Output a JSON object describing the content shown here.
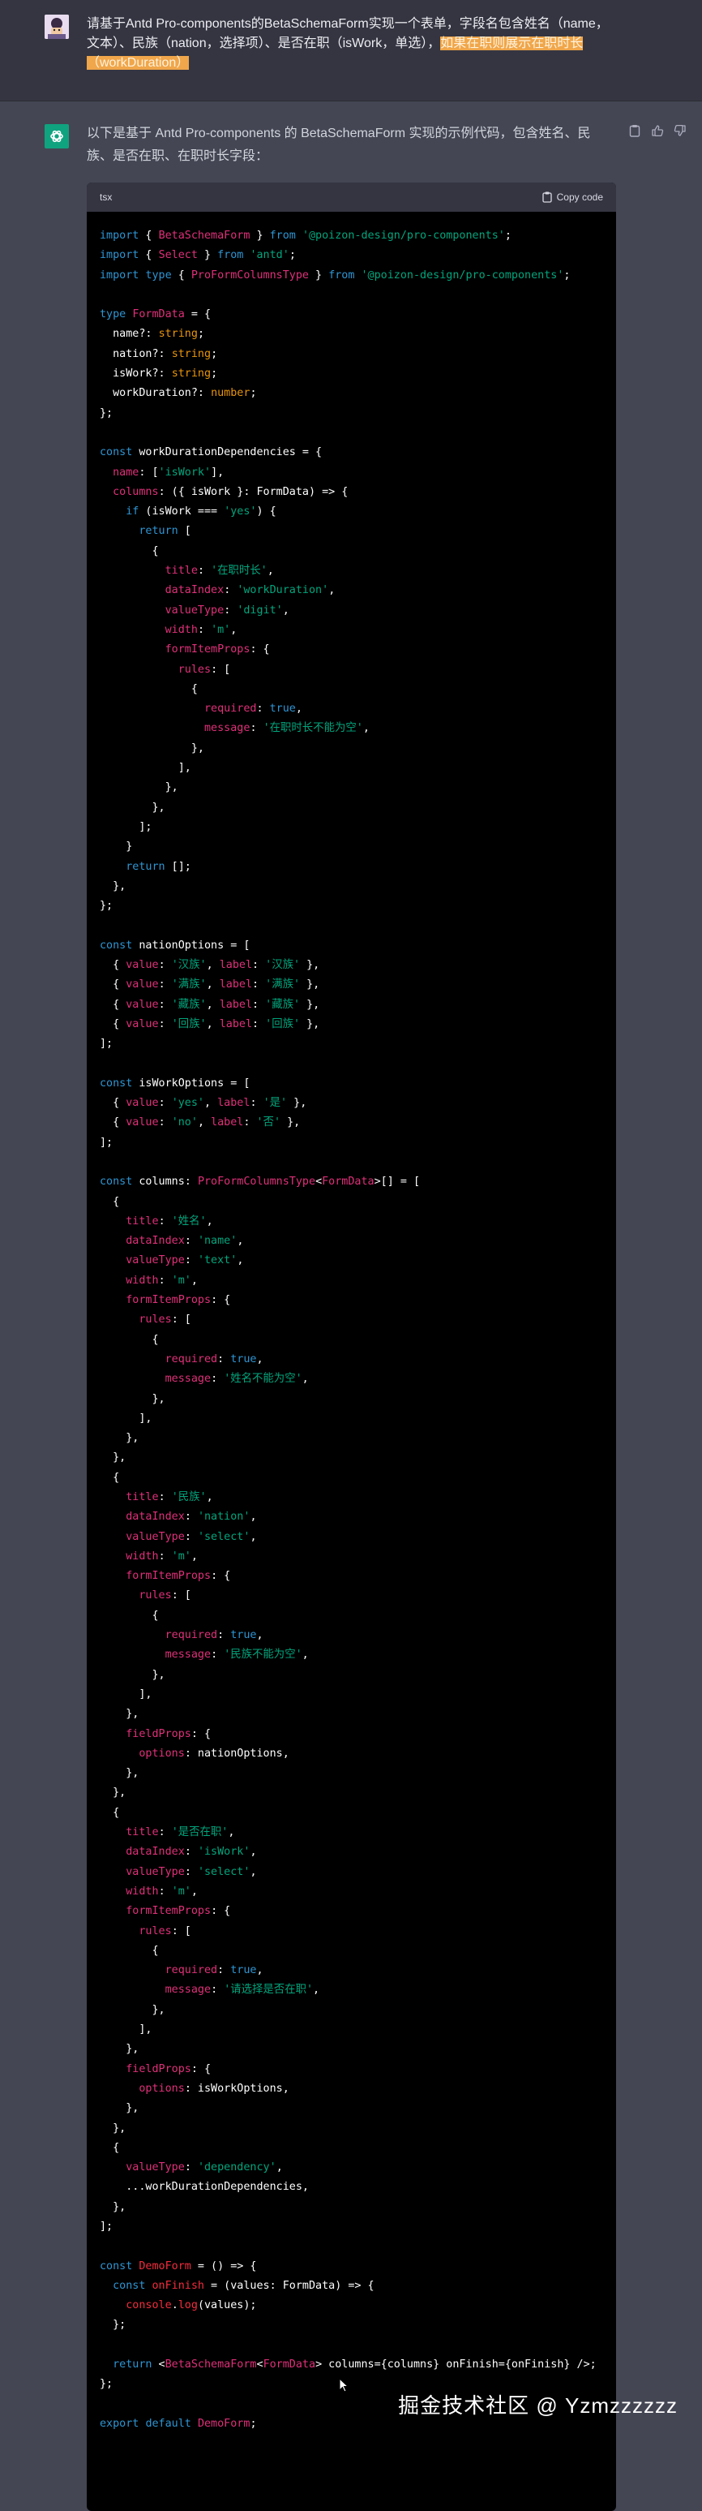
{
  "user_message": {
    "text": "请基于Antd Pro-components的BetaSchemaForm实现一个表单，字段名包含姓名（name，文本）、民族（nation，选择项）、是否在职（isWork，单选），",
    "highlight": "如果在职则展示在职时长（workDuration）"
  },
  "assistant": {
    "intro": "以下是基于 Antd Pro-components 的 BetaSchemaForm 实现的示例代码，包含姓名、民族、是否在职、在职时长字段：",
    "code_language": "tsx",
    "copy_label": "Copy code"
  },
  "watermark": "掘金技术社区 @ Yzmzzzzzz",
  "colors": {
    "page_bg": "#444654",
    "user_bg": "#343541",
    "code_bg": "#000000",
    "bot_avatar": "#10a37f",
    "highlight": "#f0a64a"
  },
  "icons": {
    "copy": "clipboard-icon",
    "thumbs_up": "thumbs-up-icon",
    "thumbs_down": "thumbs-down-icon",
    "assistant": "openai-logo-icon"
  }
}
